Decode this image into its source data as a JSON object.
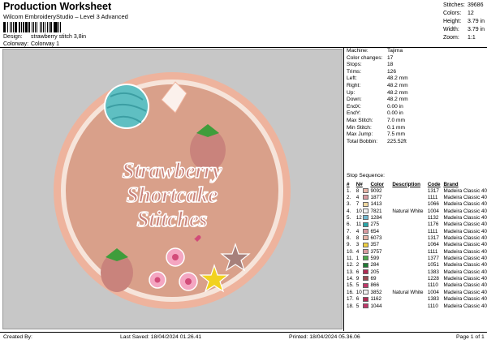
{
  "header": {
    "title": "Production Worksheet",
    "subtitle": "Wilcom EmbroideryStudio – Level 3 Advanced"
  },
  "design": {
    "design_label": "Design:",
    "design_value": "strawberry stitch 3,8in",
    "colorway_label": "Colorway:",
    "colorway_value": "Colorway 1"
  },
  "stats": [
    {
      "k": "Stitches:",
      "v": "39686"
    },
    {
      "k": "Colors:",
      "v": "12"
    },
    {
      "k": "Height:",
      "v": "3.79 in"
    },
    {
      "k": "Width:",
      "v": "3.79 in"
    },
    {
      "k": "Zoom:",
      "v": "1:1"
    }
  ],
  "artwork": {
    "lines": [
      "Strawberry",
      "Shortcake",
      "Stitches"
    ],
    "colors": {
      "canvas": "#c7c7c7",
      "border": "#eeb39d",
      "fill": "#d9a08a",
      "text": "#c9837c",
      "teal": "#5fbfc2",
      "leaf": "#3f9d3b",
      "star": "#f2d21f",
      "pink": "#d24b79"
    }
  },
  "machine_info": [
    {
      "k": "Machine:",
      "v": "Tajima"
    },
    {
      "k": "Color changes:",
      "v": "17"
    },
    {
      "k": "Stops:",
      "v": "18"
    },
    {
      "k": "Trims:",
      "v": "126"
    },
    {
      "k": "Left:",
      "v": "48.2 mm"
    },
    {
      "k": "Right:",
      "v": "48.2 mm"
    },
    {
      "k": "Up:",
      "v": "48.2 mm"
    },
    {
      "k": "Down:",
      "v": "48.2 mm"
    },
    {
      "k": "EndX:",
      "v": "0.00 in"
    },
    {
      "k": "EndY:",
      "v": "0.00 in"
    },
    {
      "k": "Max Stitch:",
      "v": "7.0 mm"
    },
    {
      "k": "Min Stitch:",
      "v": "0.1 mm"
    },
    {
      "k": "Max Jump:",
      "v": "7.5 mm"
    },
    {
      "k": "Total Bobbin:",
      "v": "225.52ft"
    }
  ],
  "sequence": {
    "title": "Stop Sequence:",
    "headers": {
      "n": "#",
      "n2": "N#",
      "color": "Color",
      "desc": "Description",
      "code": "Code",
      "brand": "Brand"
    },
    "rows": [
      {
        "stop": "1.",
        "needle": "8",
        "swatch": "#e8b4a6",
        "color": "9092",
        "desc": "",
        "code": "1317",
        "brand": "Madeira Classic 40"
      },
      {
        "stop": "2.",
        "needle": "4",
        "swatch": "#d99aa0",
        "color": "1877",
        "desc": "",
        "code": "1111",
        "brand": "Madeira Classic 40"
      },
      {
        "stop": "3.",
        "needle": "7",
        "swatch": "#f0d8a0",
        "color": "1413",
        "desc": "",
        "code": "1066",
        "brand": "Madeira Classic 40"
      },
      {
        "stop": "4.",
        "needle": "10",
        "swatch": "#f4f4f4",
        "color": "7821",
        "desc": "Natural White",
        "code": "1004",
        "brand": "Madeira Classic 40"
      },
      {
        "stop": "5.",
        "needle": "12",
        "swatch": "#6fb8d0",
        "color": "1284",
        "desc": "",
        "code": "1132",
        "brand": "Madeira Classic 40"
      },
      {
        "stop": "6.",
        "needle": "11",
        "swatch": "#2aa6a8",
        "color": "275",
        "desc": "",
        "code": "1176",
        "brand": "Madeira Classic 40"
      },
      {
        "stop": "7.",
        "needle": "4",
        "swatch": "#d99aa0",
        "color": "654",
        "desc": "",
        "code": "1111",
        "brand": "Madeira Classic 40"
      },
      {
        "stop": "8.",
        "needle": "8",
        "swatch": "#e8b4a6",
        "color": "6073",
        "desc": "",
        "code": "1317",
        "brand": "Madeira Classic 40"
      },
      {
        "stop": "9.",
        "needle": "3",
        "swatch": "#f0d040",
        "color": "357",
        "desc": "",
        "code": "1064",
        "brand": "Madeira Classic 40"
      },
      {
        "stop": "10.",
        "needle": "4",
        "swatch": "#d99aa0",
        "color": "3757",
        "desc": "",
        "code": "1111",
        "brand": "Madeira Classic 40"
      },
      {
        "stop": "11.",
        "needle": "1",
        "swatch": "#4caa4a",
        "color": "599",
        "desc": "",
        "code": "1377",
        "brand": "Madeira Classic 40"
      },
      {
        "stop": "12.",
        "needle": "2",
        "swatch": "#1f7a34",
        "color": "284",
        "desc": "",
        "code": "1051",
        "brand": "Madeira Classic 40"
      },
      {
        "stop": "13.",
        "needle": "6",
        "swatch": "#b02a52",
        "color": "205",
        "desc": "",
        "code": "1383",
        "brand": "Madeira Classic 40"
      },
      {
        "stop": "14.",
        "needle": "9",
        "swatch": "#9a4a52",
        "color": "69",
        "desc": "",
        "code": "1228",
        "brand": "Madeira Classic 40"
      },
      {
        "stop": "15.",
        "needle": "5",
        "swatch": "#c0386a",
        "color": "866",
        "desc": "",
        "code": "1110",
        "brand": "Madeira Classic 40"
      },
      {
        "stop": "16.",
        "needle": "10",
        "swatch": "#f4f4f4",
        "color": "3852",
        "desc": "Natural White",
        "code": "1004",
        "brand": "Madeira Classic 40"
      },
      {
        "stop": "17.",
        "needle": "6",
        "swatch": "#b02a52",
        "color": "1162",
        "desc": "",
        "code": "1383",
        "brand": "Madeira Classic 40"
      },
      {
        "stop": "18.",
        "needle": "5",
        "swatch": "#c0386a",
        "color": "1044",
        "desc": "",
        "code": "1110",
        "brand": "Madeira Classic 40"
      }
    ]
  },
  "footer": {
    "created_by": "Created By:",
    "last_saved": "Last Saved: 18/04/2024 01.26.41",
    "printed": "Printed: 18/04/2024 05.36.06",
    "page": "Page 1 of 1"
  }
}
